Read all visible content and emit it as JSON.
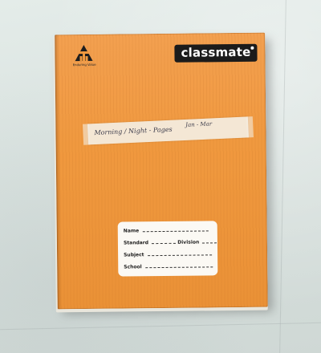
{
  "notebook": {
    "brand": "classmate",
    "logo": {
      "icon": "itc-triangle-logo",
      "caption": "Enduring Value"
    },
    "handwritten_label": {
      "main": "Morning / Night - Pages",
      "note": "Jan - Mar"
    },
    "label_fields": {
      "name": "Name",
      "standard": "Standard",
      "division": "Division",
      "subject": "Subject",
      "school": "School"
    },
    "colors": {
      "cover": "#f0993f",
      "brand_bg": "#1b1b1b",
      "label_bg": "#fbf9f4",
      "background": "#dde5e2"
    }
  }
}
